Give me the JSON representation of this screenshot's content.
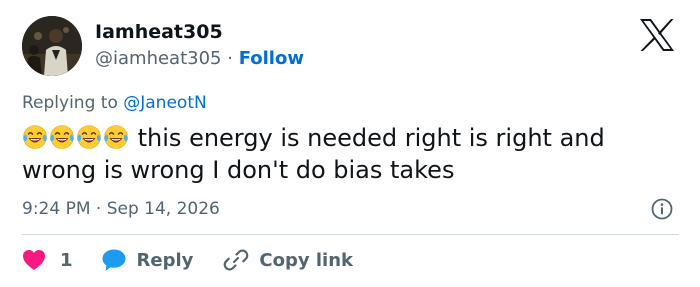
{
  "author": {
    "display_name": "Iamheat305",
    "handle": "@iamheat305",
    "separator": "·",
    "follow_label": "Follow",
    "avatar_icon": "profile-photo"
  },
  "brand": {
    "logo_icon": "x-logo-icon"
  },
  "reply_context": {
    "prefix": "Replying to",
    "mention": "@JaneotN"
  },
  "tweet": {
    "emojis": [
      "face-with-tears-of-joy",
      "face-with-tears-of-joy",
      "face-with-tears-of-joy",
      "face-with-tears-of-joy"
    ],
    "text": "this energy is needed right is right and wrong is wrong I don't do bias takes"
  },
  "meta": {
    "time": "9:24 PM",
    "separator": "·",
    "date": "Sep 14, 2026",
    "info_icon": "info-icon"
  },
  "actions": {
    "like_count": "1",
    "like_icon": "heart-icon",
    "reply_label": "Reply",
    "reply_icon": "speech-bubble-icon",
    "copy_label": "Copy link",
    "copy_icon": "link-icon"
  },
  "colors": {
    "link": "#006fd6",
    "secondary_text": "#536471",
    "primary_text": "#0f1419",
    "like": "#f91880",
    "reply": "#1d9bf0",
    "divider": "#cfd9de"
  }
}
